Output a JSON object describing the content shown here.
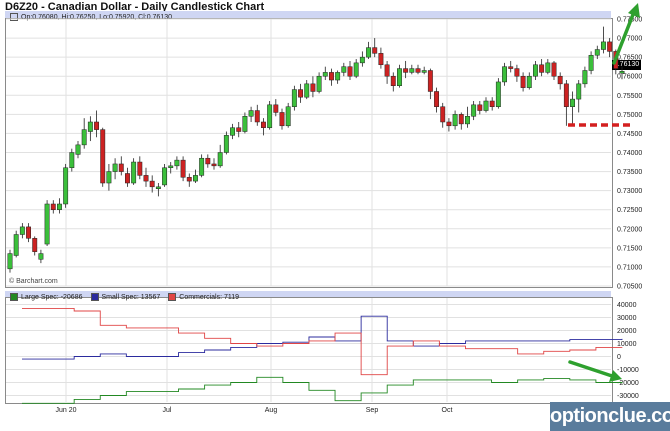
{
  "title": "D6Z20 - Canadian Dollar - Daily Candlestick Chart",
  "ohlc_readout": "Op:0.76080, Hi:0.76250, Lo:0.75920, Cl:0.76130",
  "last_price_label": "0.76130",
  "source_label": "© Barchart.com",
  "watermark": "optionclue.com",
  "colors": {
    "up": "#3bbf3b",
    "down": "#cc2222",
    "large_spec": "#228822",
    "small_spec": "#2b2b9e",
    "commercials": "#e04545",
    "arrow": "#2ea02e",
    "support_line": "#d41f1f",
    "header_bar": "#cfd6f3"
  },
  "indicator_legend": [
    {
      "label": "Large Spec: -20686",
      "color": "#228822"
    },
    {
      "label": "Small Spec: 13567",
      "color": "#2b2b9e"
    },
    {
      "label": "Commercials: 7119",
      "color": "#e04545"
    }
  ],
  "x_labels": [
    "Jun 20",
    "Jul",
    "Aug",
    "Sep",
    "Oct"
  ],
  "chart_data": [
    {
      "type": "candlestick",
      "title": "D6Z20 - Canadian Dollar - Daily Candlestick Chart",
      "ylim": [
        0.705,
        0.775
      ],
      "y_ticks": [
        "0.70500",
        "0.71000",
        "0.71500",
        "0.72000",
        "0.72500",
        "0.73000",
        "0.73500",
        "0.74000",
        "0.74500",
        "0.75000",
        "0.75500",
        "0.76000",
        "0.76500",
        "0.77000",
        "0.77500"
      ],
      "x_labels": [
        "Jun 20",
        "Jul",
        "Aug",
        "Sep",
        "Oct"
      ],
      "grid": true,
      "support_level": 0.7472,
      "trend_arrow": "up",
      "candles": [
        [
          0.7095,
          0.7135,
          0.7085,
          0.7145
        ],
        [
          0.713,
          0.7185,
          0.7125,
          0.7195
        ],
        [
          0.7185,
          0.7205,
          0.7175,
          0.7215
        ],
        [
          0.7205,
          0.7175,
          0.7165,
          0.7215
        ],
        [
          0.7175,
          0.714,
          0.713,
          0.718
        ],
        [
          0.712,
          0.7135,
          0.711,
          0.7145
        ],
        [
          0.716,
          0.7265,
          0.7155,
          0.7275
        ],
        [
          0.7265,
          0.725,
          0.724,
          0.7275
        ],
        [
          0.725,
          0.7265,
          0.724,
          0.728
        ],
        [
          0.7265,
          0.736,
          0.7255,
          0.737
        ],
        [
          0.736,
          0.74,
          0.735,
          0.741
        ],
        [
          0.7395,
          0.742,
          0.7385,
          0.743
        ],
        [
          0.742,
          0.746,
          0.741,
          0.749
        ],
        [
          0.7455,
          0.748,
          0.743,
          0.7495
        ],
        [
          0.748,
          0.746,
          0.744,
          0.751
        ],
        [
          0.746,
          0.732,
          0.731,
          0.7465
        ],
        [
          0.732,
          0.735,
          0.73,
          0.737
        ],
        [
          0.735,
          0.737,
          0.733,
          0.7385
        ],
        [
          0.737,
          0.735,
          0.734,
          0.739
        ],
        [
          0.7345,
          0.732,
          0.731,
          0.736
        ],
        [
          0.732,
          0.7375,
          0.7315,
          0.7385
        ],
        [
          0.7375,
          0.734,
          0.733,
          0.739
        ],
        [
          0.734,
          0.7325,
          0.731,
          0.736
        ],
        [
          0.7325,
          0.731,
          0.7295,
          0.734
        ],
        [
          0.7305,
          0.731,
          0.7285,
          0.732
        ],
        [
          0.7315,
          0.736,
          0.731,
          0.737
        ],
        [
          0.736,
          0.7365,
          0.7345,
          0.7375
        ],
        [
          0.7365,
          0.738,
          0.7355,
          0.739
        ],
        [
          0.738,
          0.7335,
          0.7325,
          0.739
        ],
        [
          0.7335,
          0.7325,
          0.731,
          0.7345
        ],
        [
          0.7325,
          0.734,
          0.732,
          0.7355
        ],
        [
          0.734,
          0.7385,
          0.7335,
          0.7395
        ],
        [
          0.7385,
          0.737,
          0.736,
          0.7395
        ],
        [
          0.737,
          0.7365,
          0.7355,
          0.7385
        ],
        [
          0.7365,
          0.74,
          0.736,
          0.742
        ],
        [
          0.74,
          0.7445,
          0.7395,
          0.7455
        ],
        [
          0.7445,
          0.7465,
          0.7435,
          0.7475
        ],
        [
          0.7465,
          0.7455,
          0.744,
          0.748
        ],
        [
          0.7455,
          0.7495,
          0.745,
          0.7505
        ],
        [
          0.7495,
          0.751,
          0.748,
          0.752
        ],
        [
          0.751,
          0.748,
          0.747,
          0.7525
        ],
        [
          0.748,
          0.7465,
          0.7445,
          0.749
        ],
        [
          0.7465,
          0.7525,
          0.746,
          0.7535
        ],
        [
          0.7525,
          0.7505,
          0.7495,
          0.754
        ],
        [
          0.7505,
          0.747,
          0.746,
          0.7515
        ],
        [
          0.747,
          0.752,
          0.7465,
          0.753
        ],
        [
          0.752,
          0.7565,
          0.751,
          0.7575
        ],
        [
          0.7565,
          0.7545,
          0.753,
          0.758
        ],
        [
          0.7545,
          0.758,
          0.754,
          0.759
        ],
        [
          0.758,
          0.756,
          0.7545,
          0.76
        ],
        [
          0.756,
          0.76,
          0.7555,
          0.761
        ],
        [
          0.76,
          0.761,
          0.759,
          0.7625
        ],
        [
          0.761,
          0.759,
          0.7575,
          0.762
        ],
        [
          0.759,
          0.761,
          0.758,
          0.7615
        ],
        [
          0.761,
          0.7625,
          0.76,
          0.7635
        ],
        [
          0.7625,
          0.76,
          0.759,
          0.764
        ],
        [
          0.76,
          0.7635,
          0.7595,
          0.7645
        ],
        [
          0.7635,
          0.765,
          0.7625,
          0.7665
        ],
        [
          0.765,
          0.7675,
          0.7645,
          0.769
        ],
        [
          0.7675,
          0.766,
          0.765,
          0.77
        ],
        [
          0.766,
          0.763,
          0.762,
          0.7675
        ],
        [
          0.763,
          0.76,
          0.758,
          0.764
        ],
        [
          0.76,
          0.7575,
          0.756,
          0.761
        ],
        [
          0.7575,
          0.762,
          0.757,
          0.763
        ],
        [
          0.762,
          0.761,
          0.7595,
          0.764
        ],
        [
          0.761,
          0.762,
          0.7605,
          0.763
        ],
        [
          0.762,
          0.761,
          0.7605,
          0.763
        ],
        [
          0.761,
          0.7615,
          0.7605,
          0.7625
        ],
        [
          0.7615,
          0.756,
          0.754,
          0.762
        ],
        [
          0.756,
          0.752,
          0.7505,
          0.757
        ],
        [
          0.752,
          0.748,
          0.7465,
          0.753
        ],
        [
          0.748,
          0.747,
          0.7455,
          0.749
        ],
        [
          0.747,
          0.75,
          0.746,
          0.751
        ],
        [
          0.75,
          0.7475,
          0.746,
          0.7505
        ],
        [
          0.7475,
          0.7495,
          0.7465,
          0.752
        ],
        [
          0.7495,
          0.7525,
          0.7485,
          0.7535
        ],
        [
          0.7525,
          0.751,
          0.75,
          0.7535
        ],
        [
          0.751,
          0.7535,
          0.7505,
          0.7545
        ],
        [
          0.7535,
          0.752,
          0.751,
          0.7545
        ],
        [
          0.752,
          0.7585,
          0.7515,
          0.7595
        ],
        [
          0.7585,
          0.7625,
          0.7575,
          0.7635
        ],
        [
          0.7625,
          0.762,
          0.761,
          0.764
        ],
        [
          0.762,
          0.76,
          0.7585,
          0.763
        ],
        [
          0.76,
          0.757,
          0.756,
          0.761
        ],
        [
          0.757,
          0.76,
          0.7565,
          0.761
        ],
        [
          0.76,
          0.763,
          0.759,
          0.764
        ],
        [
          0.763,
          0.761,
          0.76,
          0.7645
        ],
        [
          0.761,
          0.7635,
          0.7605,
          0.7645
        ],
        [
          0.7635,
          0.76,
          0.759,
          0.764
        ],
        [
          0.76,
          0.758,
          0.7565,
          0.761
        ],
        [
          0.758,
          0.752,
          0.747,
          0.759
        ],
        [
          0.752,
          0.754,
          0.7475,
          0.756
        ],
        [
          0.754,
          0.758,
          0.7505,
          0.759
        ],
        [
          0.758,
          0.7615,
          0.757,
          0.7625
        ],
        [
          0.7615,
          0.7655,
          0.7605,
          0.7665
        ],
        [
          0.7655,
          0.767,
          0.7645,
          0.768
        ],
        [
          0.767,
          0.769,
          0.766,
          0.773
        ],
        [
          0.769,
          0.7665,
          0.765,
          0.77
        ],
        [
          0.7665,
          0.762,
          0.7605,
          0.767
        ],
        [
          0.7608,
          0.7613,
          0.7592,
          0.7625
        ]
      ]
    },
    {
      "type": "line",
      "ylim": [
        -35000,
        45000
      ],
      "y_ticks": [
        "40000",
        "30000",
        "20000",
        "10000",
        "0",
        "-10000",
        "-20000",
        "-30000"
      ],
      "x_labels": [
        "Jun 20",
        "Jul",
        "Aug",
        "Sep",
        "Oct"
      ],
      "grid": true,
      "trend_arrow": "down",
      "series": [
        {
          "name": "Large Spec",
          "color": "#228822",
          "values": [
            -36000,
            -36000,
            -33000,
            -30000,
            -27000,
            -27000,
            -25000,
            -22000,
            -20000,
            -16000,
            -20000,
            -26000,
            -34000,
            -28000,
            -22000,
            -18000,
            -18000,
            -18000,
            -20000,
            -18000,
            -17000,
            -18000,
            -20000,
            -20686
          ]
        },
        {
          "name": "Small Spec",
          "color": "#2b2b9e",
          "values": [
            -2000,
            -2000,
            0,
            2000,
            0,
            0,
            3000,
            5000,
            7000,
            10000,
            11000,
            15000,
            12000,
            31000,
            12000,
            8000,
            10000,
            12000,
            12000,
            12000,
            12000,
            13000,
            13000,
            13567
          ]
        },
        {
          "name": "Commercials",
          "color": "#e04545",
          "values": [
            37000,
            37000,
            35000,
            24000,
            22000,
            22000,
            18000,
            14000,
            10000,
            8000,
            10000,
            12000,
            18000,
            -14000,
            8000,
            12000,
            8000,
            6000,
            6000,
            2000,
            4000,
            5000,
            7000,
            7119
          ]
        }
      ]
    }
  ]
}
